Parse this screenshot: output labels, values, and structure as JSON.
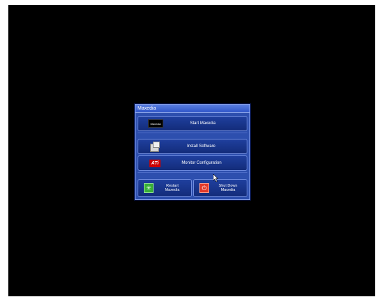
{
  "window": {
    "title": "Maxedia"
  },
  "buttons": {
    "start": {
      "label": "Start Maxedia",
      "icon": "maxedia-logo",
      "icon_text": "Maxedia"
    },
    "install": {
      "label": "Install Software",
      "icon": "software-box-icon"
    },
    "monitor": {
      "label": "Monitor Configuration",
      "icon": "ati-logo",
      "icon_text": "ATi"
    },
    "restart": {
      "label_line1": "Restart",
      "label_line2": "Maxedia",
      "icon": "restart-icon"
    },
    "shutdown": {
      "label_line1": "Shut Down",
      "label_line2": "Maxedia",
      "icon": "power-icon"
    }
  },
  "colors": {
    "window_bg": "#2d4fae",
    "button_bg": "#1f3f9e",
    "titlebar": "#3a62d4",
    "screen_bg": "#000000"
  }
}
